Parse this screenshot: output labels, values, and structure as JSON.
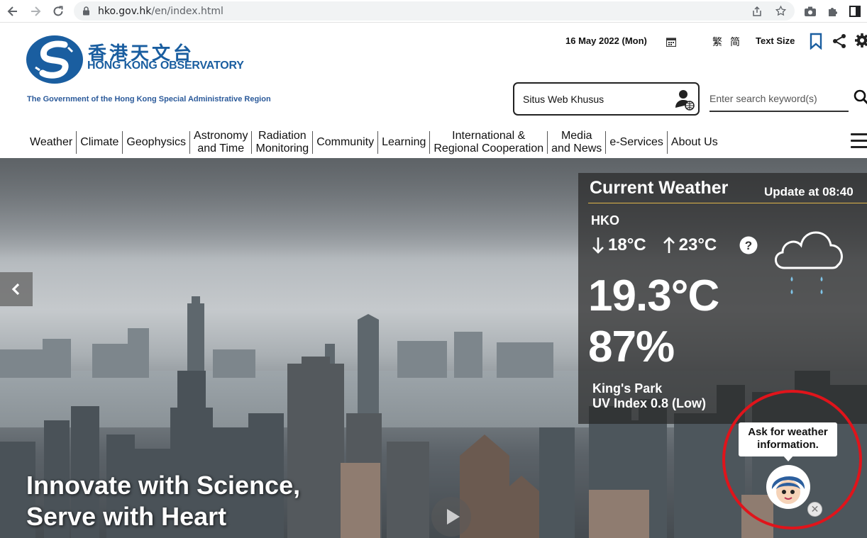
{
  "browser": {
    "url_host": "hko.gov.hk",
    "url_path": "/en/index.html"
  },
  "header": {
    "logo_zh": "香港天文台",
    "logo_en": "HONG KONG OBSERVATORY",
    "gov_line": "The Government of the Hong Kong Special Administrative Region",
    "date": "16 May 2022 (Mon)",
    "lang_traditional": "繁",
    "lang_simplified": "简",
    "text_size": "Text Size",
    "special_site": "Situs Web Khusus",
    "search_placeholder": "Enter search keyword(s)"
  },
  "nav": {
    "items": [
      {
        "label": "Weather"
      },
      {
        "label": "Climate"
      },
      {
        "label": "Geophysics"
      },
      {
        "label": "Astronomy\nand Time"
      },
      {
        "label": "Radiation\nMonitoring"
      },
      {
        "label": "Community"
      },
      {
        "label": "Learning"
      },
      {
        "label": "International &\nRegional Cooperation"
      },
      {
        "label": "Media\nand News"
      },
      {
        "label": "e-Services"
      },
      {
        "label": "About Us"
      }
    ]
  },
  "hero": {
    "slogan_line1": "Innovate with Science,",
    "slogan_line2": "Serve with Heart"
  },
  "current_weather": {
    "title": "Current Weather",
    "update": "Update at 08:40",
    "station": "HKO",
    "min_temp": "18°C",
    "max_temp": "23°C",
    "temperature": "19.3°C",
    "humidity": "87%",
    "uv_station": "King's Park",
    "uv_index": "UV Index 0.8 (Low)",
    "weather_icon": "cloud-rain-icon"
  },
  "chatbot": {
    "bubble_line1": "Ask for weather",
    "bubble_line2": "information."
  },
  "colors": {
    "brand_blue": "#1a5ea0",
    "accent_gold": "#e0b64a",
    "highlight_red": "#e0141b"
  }
}
